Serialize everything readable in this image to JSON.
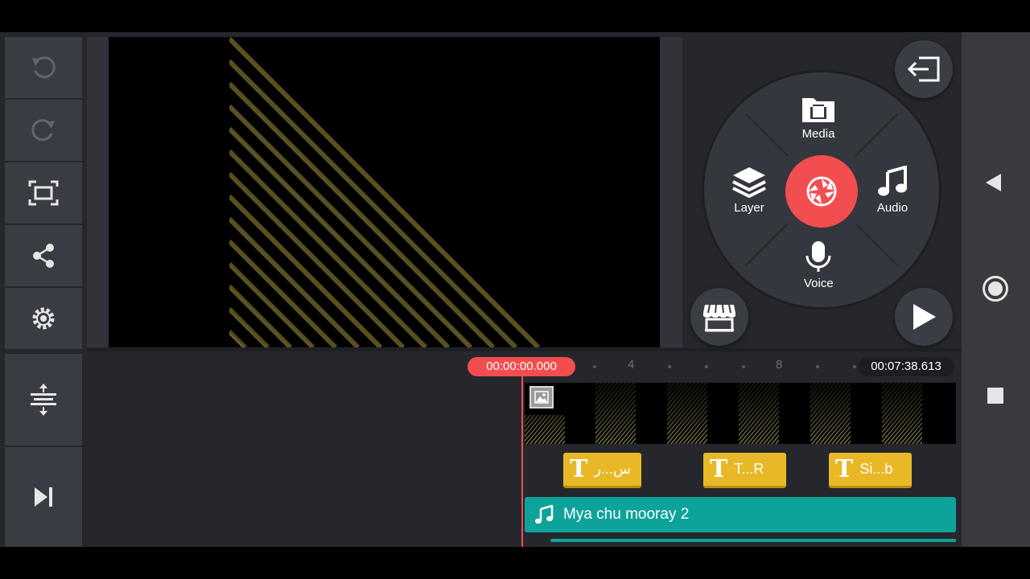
{
  "toolbar": {
    "items": [
      {
        "name": "undo",
        "icon": "undo-icon"
      },
      {
        "name": "redo",
        "icon": "redo-icon"
      },
      {
        "name": "aspect",
        "icon": "aspect-ratio-icon"
      },
      {
        "name": "share",
        "icon": "share-icon"
      },
      {
        "name": "settings",
        "icon": "gear-icon"
      },
      {
        "name": "expand-timeline",
        "icon": "expand-timeline-icon"
      },
      {
        "name": "jump-to-end",
        "icon": "skip-end-icon"
      }
    ]
  },
  "wheel": {
    "media_label": "Media",
    "layer_label": "Layer",
    "audio_label": "Audio",
    "voice_label": "Voice"
  },
  "timeline": {
    "current_time": "00:00:00.000",
    "total_time": "00:07:38.613",
    "ruler_marks": [
      "4",
      "8"
    ],
    "text_clips": [
      "س...ر",
      "T...R",
      "Si...b"
    ],
    "audio_clip": "Mya chu mooray 2"
  },
  "colors": {
    "accent": "#f24d4f",
    "panel": "#393c43",
    "text_clip": "#e8b827",
    "audio_clip": "#0ea39a"
  }
}
